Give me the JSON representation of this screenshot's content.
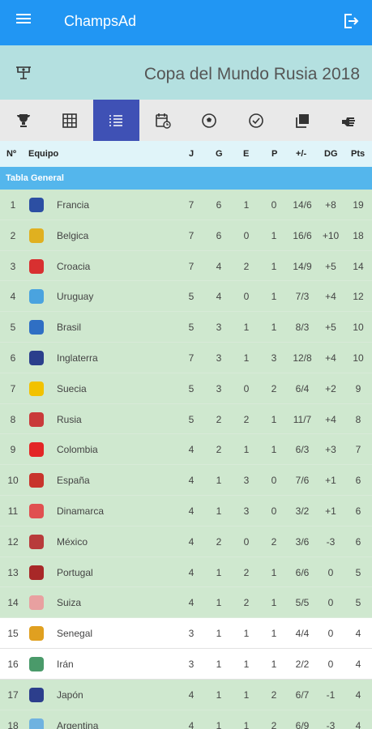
{
  "app": {
    "title": "ChampsAd"
  },
  "banner": {
    "competition": "Copa del Mundo Rusia 2018"
  },
  "tabs": [
    {
      "icon": "trophy-icon",
      "active": false
    },
    {
      "icon": "grid-icon",
      "active": false
    },
    {
      "icon": "list-icon",
      "active": true
    },
    {
      "icon": "calendar-clock-icon",
      "active": false
    },
    {
      "icon": "soccer-ball-icon",
      "active": false
    },
    {
      "icon": "check-circle-icon",
      "active": false
    },
    {
      "icon": "copy-icon",
      "active": false
    },
    {
      "icon": "hand-pointer-icon",
      "active": false
    }
  ],
  "table": {
    "columns": [
      "Nº",
      "Equipo",
      "J",
      "G",
      "E",
      "P",
      "+/-",
      "DG",
      "Pts"
    ],
    "group_label": "Tabla General",
    "rows": [
      {
        "pos": "1",
        "team": "Francia",
        "j": "7",
        "g": "6",
        "e": "1",
        "p": "0",
        "gf": "14/6",
        "dg": "+8",
        "pts": "19",
        "color": "#2c4fa3",
        "highlight": "green"
      },
      {
        "pos": "2",
        "team": "Belgica",
        "j": "7",
        "g": "6",
        "e": "0",
        "p": "1",
        "gf": "16/6",
        "dg": "+10",
        "pts": "18",
        "color": "#e0b020",
        "highlight": "green"
      },
      {
        "pos": "3",
        "team": "Croacia",
        "j": "7",
        "g": "4",
        "e": "2",
        "p": "1",
        "gf": "14/9",
        "dg": "+5",
        "pts": "14",
        "color": "#d83030",
        "highlight": "green"
      },
      {
        "pos": "4",
        "team": "Uruguay",
        "j": "5",
        "g": "4",
        "e": "0",
        "p": "1",
        "gf": "7/3",
        "dg": "+4",
        "pts": "12",
        "color": "#4aa3df",
        "highlight": "green"
      },
      {
        "pos": "5",
        "team": "Brasil",
        "j": "5",
        "g": "3",
        "e": "1",
        "p": "1",
        "gf": "8/3",
        "dg": "+5",
        "pts": "10",
        "color": "#2f6fc4",
        "highlight": "green"
      },
      {
        "pos": "6",
        "team": "Inglaterra",
        "j": "7",
        "g": "3",
        "e": "1",
        "p": "3",
        "gf": "12/8",
        "dg": "+4",
        "pts": "10",
        "color": "#2b3f8c",
        "highlight": "green"
      },
      {
        "pos": "7",
        "team": "Suecia",
        "j": "5",
        "g": "3",
        "e": "0",
        "p": "2",
        "gf": "6/4",
        "dg": "+2",
        "pts": "9",
        "color": "#f2c200",
        "highlight": "green"
      },
      {
        "pos": "8",
        "team": "Rusia",
        "j": "5",
        "g": "2",
        "e": "2",
        "p": "1",
        "gf": "11/7",
        "dg": "+4",
        "pts": "8",
        "color": "#c93a3a",
        "highlight": "green"
      },
      {
        "pos": "9",
        "team": "Colombia",
        "j": "4",
        "g": "2",
        "e": "1",
        "p": "1",
        "gf": "6/3",
        "dg": "+3",
        "pts": "7",
        "color": "#e32626",
        "highlight": "green"
      },
      {
        "pos": "10",
        "team": "España",
        "j": "4",
        "g": "1",
        "e": "3",
        "p": "0",
        "gf": "7/6",
        "dg": "+1",
        "pts": "6",
        "color": "#c8342c",
        "highlight": "green"
      },
      {
        "pos": "11",
        "team": "Dinamarca",
        "j": "4",
        "g": "1",
        "e": "3",
        "p": "0",
        "gf": "3/2",
        "dg": "+1",
        "pts": "6",
        "color": "#e05050",
        "highlight": "green"
      },
      {
        "pos": "12",
        "team": "México",
        "j": "4",
        "g": "2",
        "e": "0",
        "p": "2",
        "gf": "3/6",
        "dg": "-3",
        "pts": "6",
        "color": "#b83b3b",
        "highlight": "green"
      },
      {
        "pos": "13",
        "team": "Portugal",
        "j": "4",
        "g": "1",
        "e": "2",
        "p": "1",
        "gf": "6/6",
        "dg": "0",
        "pts": "5",
        "color": "#a82828",
        "highlight": "green"
      },
      {
        "pos": "14",
        "team": "Suiza",
        "j": "4",
        "g": "1",
        "e": "2",
        "p": "1",
        "gf": "5/5",
        "dg": "0",
        "pts": "5",
        "color": "#e8a0a0",
        "highlight": "green"
      },
      {
        "pos": "15",
        "team": "Senegal",
        "j": "3",
        "g": "1",
        "e": "1",
        "p": "1",
        "gf": "4/4",
        "dg": "0",
        "pts": "4",
        "color": "#e0a020",
        "highlight": "white"
      },
      {
        "pos": "16",
        "team": "Irán",
        "j": "3",
        "g": "1",
        "e": "1",
        "p": "1",
        "gf": "2/2",
        "dg": "0",
        "pts": "4",
        "color": "#4a9a6a",
        "highlight": "white"
      },
      {
        "pos": "17",
        "team": "Japón",
        "j": "4",
        "g": "1",
        "e": "1",
        "p": "2",
        "gf": "6/7",
        "dg": "-1",
        "pts": "4",
        "color": "#2c3e8c",
        "highlight": "green"
      },
      {
        "pos": "18",
        "team": "Argentina",
        "j": "4",
        "g": "1",
        "e": "1",
        "p": "2",
        "gf": "6/9",
        "dg": "-3",
        "pts": "4",
        "color": "#6fb2e0",
        "highlight": "green"
      }
    ]
  }
}
